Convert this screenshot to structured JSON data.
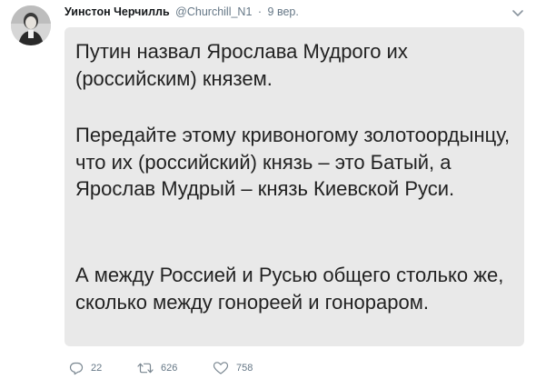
{
  "author": {
    "display_name": "Уинстон Черчилль",
    "handle": "@Churchill_N1",
    "separator": "·",
    "time": "9 вер."
  },
  "tweet": {
    "paragraphs": [
      "Путин назвал Ярослава Мудрого их (российским) князем.",
      "Передайте этому кривоногому золотоордынцу, что их (российский) князь – это Батый, а Ярослав Мудрый – князь Киевской Руси.",
      "А между Россией и Русью общего столько же, сколько между гонореей и гонораром."
    ]
  },
  "actions": {
    "reply_count": "22",
    "retweet_count": "626",
    "like_count": "758"
  },
  "icons": {
    "avatar": "avatar-portrait",
    "menu": "chevron-down-icon",
    "reply": "reply-icon",
    "retweet": "retweet-icon",
    "like": "heart-icon"
  },
  "colors": {
    "name": "#14171a",
    "meta": "#657786",
    "text_box_bg": "#e9e9e9",
    "text": "#222222"
  }
}
